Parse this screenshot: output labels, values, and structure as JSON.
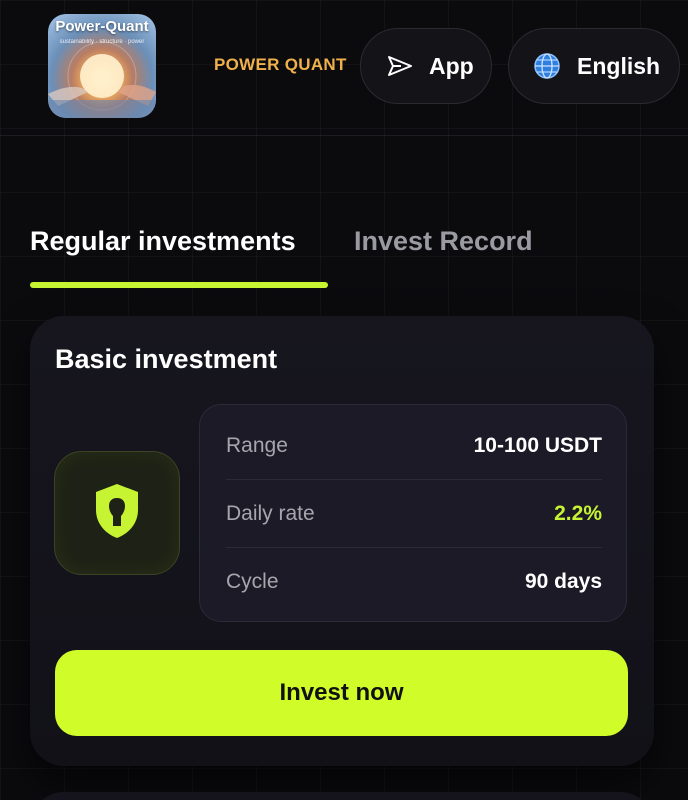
{
  "header": {
    "logo_text": "Power-Quant",
    "logo_subtext": "sustainability · structure · power",
    "brand": "POWER QUANT",
    "app_label": "App",
    "language_label": "English"
  },
  "tabs": [
    {
      "label": "Regular investments",
      "active": true
    },
    {
      "label": "Invest Record",
      "active": false
    }
  ],
  "plan": {
    "title": "Basic investment",
    "rows": [
      {
        "label": "Range",
        "value": "10-100 USDT"
      },
      {
        "label": "Daily rate",
        "value": "2.2%"
      },
      {
        "label": "Cycle",
        "value": "90 days"
      }
    ],
    "button_label": "Invest now"
  },
  "colors": {
    "accent": "#c6f432",
    "brand": "#f0b04a",
    "background": "#0b0b0e"
  },
  "icons": [
    "send-icon",
    "globe-icon",
    "shield-icon"
  ]
}
